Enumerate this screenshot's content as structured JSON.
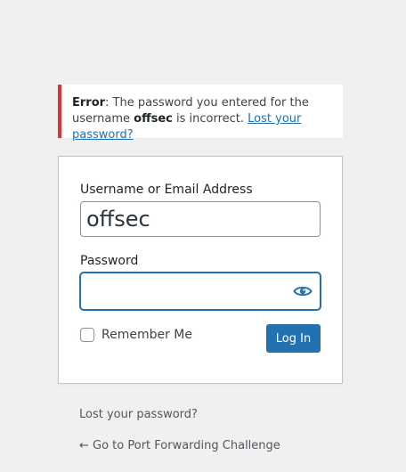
{
  "notice": {
    "error_label": "Error",
    "message_part1": ": The password you entered for the username ",
    "username": "offsec",
    "message_part2": " is incorrect. ",
    "lost_link": "Lost your password?"
  },
  "form": {
    "username_label": "Username or Email Address",
    "username_value": "offsec",
    "password_label": "Password",
    "password_value": "",
    "password_toggle_icon": "eye-icon",
    "remember_label": "Remember Me",
    "remember_checked": false,
    "login_button": "Log In"
  },
  "nav": {
    "lost_password": "Lost your password?",
    "back_link": "← Go to Port Forwarding Challenge"
  },
  "colors": {
    "accent": "#2271b1",
    "error": "#d63638",
    "background": "#f0f0f1"
  }
}
